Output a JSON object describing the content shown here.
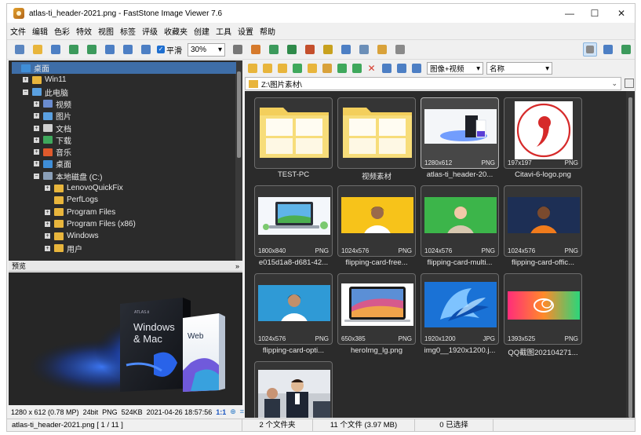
{
  "window": {
    "title": "atlas-ti_header-2021.png  -  FastStone Image Viewer 7.6",
    "controls": {
      "minimize": "—",
      "maximize": "☐",
      "close": "✕"
    }
  },
  "menu": [
    "文件",
    "编辑",
    "色彩",
    "特效",
    "视图",
    "标签",
    "评级",
    "收藏夹",
    "创建",
    "工具",
    "设置",
    "帮助"
  ],
  "toolbar": {
    "smooth_label": "平滑",
    "smooth_checked": true,
    "zoom_value": "30%",
    "icons": [
      "open-folder-icon",
      "browse-icon",
      "save-icon",
      "previous-icon",
      "next-icon",
      "zoom-in-icon",
      "zoom-out-icon",
      "fit-icon",
      "hand-icon",
      "crop-icon",
      "resize-icon",
      "rotate-left-icon",
      "rotate-right-icon",
      "draw-icon",
      "compare-icon",
      "slideshow-icon",
      "email-icon",
      "print-icon",
      "scan-icon",
      "acquire-icon",
      "full-screen-icon"
    ]
  },
  "tree": {
    "items": [
      {
        "label": "桌面",
        "icon": "desktop-icon",
        "level": 0,
        "expander": "",
        "selected": true
      },
      {
        "label": "Win11",
        "icon": "folder-icon",
        "level": 1,
        "expander": "+"
      },
      {
        "label": "此电脑",
        "icon": "computer-icon",
        "level": 1,
        "expander": "−"
      },
      {
        "label": "视频",
        "icon": "video-folder-icon",
        "level": 2,
        "expander": "+"
      },
      {
        "label": "图片",
        "icon": "pictures-folder-icon",
        "level": 2,
        "expander": "+"
      },
      {
        "label": "文档",
        "icon": "documents-folder-icon",
        "level": 2,
        "expander": "+"
      },
      {
        "label": "下载",
        "icon": "downloads-folder-icon",
        "level": 2,
        "expander": "+"
      },
      {
        "label": "音乐",
        "icon": "music-folder-icon",
        "level": 2,
        "expander": "+"
      },
      {
        "label": "桌面",
        "icon": "desktop-icon",
        "level": 2,
        "expander": "+"
      },
      {
        "label": "本地磁盘 (C:)",
        "icon": "drive-icon",
        "level": 2,
        "expander": "−"
      },
      {
        "label": "LenovoQuickFix",
        "icon": "folder-icon",
        "level": 3,
        "expander": "+"
      },
      {
        "label": "PerfLogs",
        "icon": "folder-icon",
        "level": 3,
        "expander": ""
      },
      {
        "label": "Program Files",
        "icon": "folder-icon",
        "level": 3,
        "expander": "+"
      },
      {
        "label": "Program Files (x86)",
        "icon": "folder-icon",
        "level": 3,
        "expander": "+"
      },
      {
        "label": "Windows",
        "icon": "folder-icon",
        "level": 3,
        "expander": "+"
      },
      {
        "label": "用户",
        "icon": "folder-icon",
        "level": 3,
        "expander": "+"
      }
    ]
  },
  "preview": {
    "title": "预览",
    "collapse_glyph": "»",
    "box_left_line1": "Windows",
    "box_left_line2": "& Mac",
    "box_right": "Web",
    "brand": "ATLAS.ti"
  },
  "image_info": {
    "dimensions": "1280 x 612 (0.78 MP)",
    "bit_depth": "24bit",
    "format": "PNG",
    "size": "524KB",
    "date": "2021-04-26 18:57:56",
    "ratio": "1:1"
  },
  "nav": {
    "filter": "图像+视频",
    "sort": "名称",
    "path": "Z:\\图片素材\\"
  },
  "thumbnails": [
    {
      "label": "TEST-PC",
      "kind": "folder",
      "dims": "",
      "fmt": ""
    },
    {
      "label": "视频素材",
      "kind": "folder",
      "dims": "",
      "fmt": ""
    },
    {
      "label": "atlas-ti_header-20...",
      "kind": "atlas",
      "dims": "1280x612",
      "fmt": "PNG",
      "selected": true
    },
    {
      "label": "Citavi-6-logo.png",
      "kind": "citavi",
      "dims": "197x197",
      "fmt": "PNG"
    },
    {
      "label": "e015d1a8-d681-42...",
      "kind": "laptop",
      "dims": "1800x840",
      "fmt": "PNG"
    },
    {
      "label": "flipping-card-free...",
      "kind": "yellow-person",
      "dims": "1024x576",
      "fmt": "PNG"
    },
    {
      "label": "flipping-card-multi...",
      "kind": "green-person",
      "dims": "1024x576",
      "fmt": "PNG"
    },
    {
      "label": "flipping-card-offic...",
      "kind": "navy-person",
      "dims": "1024x576",
      "fmt": "PNG"
    },
    {
      "label": "flipping-card-opti...",
      "kind": "blue-person",
      "dims": "1024x576",
      "fmt": "PNG"
    },
    {
      "label": "heroImg_lg.png",
      "kind": "macbook",
      "dims": "650x385",
      "fmt": "PNG"
    },
    {
      "label": "img0__1920x1200.j...",
      "kind": "win11",
      "dims": "1920x1200",
      "fmt": "JPG"
    },
    {
      "label": "QQ截图202104271...",
      "kind": "gradient-cloud",
      "dims": "1393x525",
      "fmt": "PNG"
    },
    {
      "label": "",
      "kind": "meeting",
      "dims": "",
      "fmt": ""
    }
  ],
  "status": {
    "file": "atlas-ti_header-2021.png [ 1 / 11 ]",
    "folders": "2 个文件夹",
    "files": "11 个文件 (3.97 MB)",
    "selected": "0 已选择"
  }
}
